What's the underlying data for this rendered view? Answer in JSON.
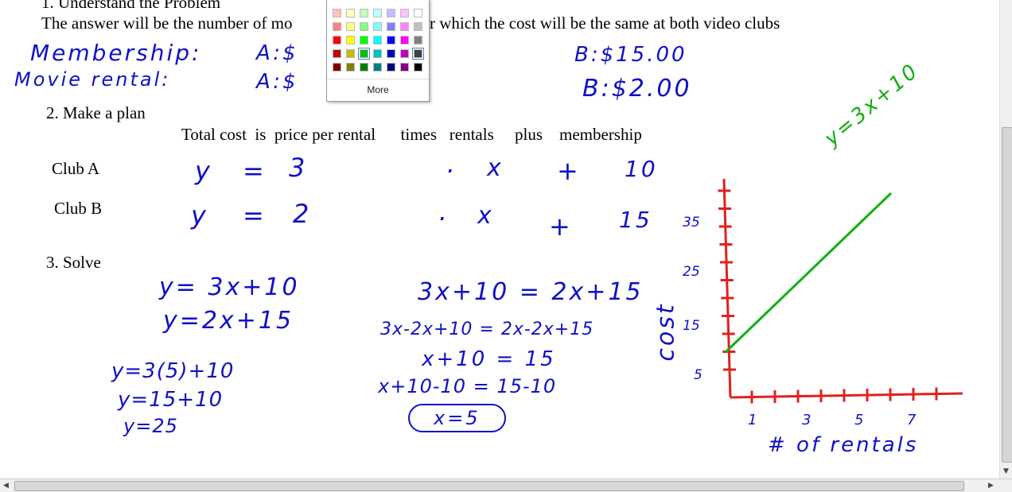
{
  "text": {
    "step1": "1. Understand the Problem",
    "answer": "The answer will be the number of mo",
    "answer_rest": "r which the cost will be the same at both video clubs",
    "step2": "2. Make a plan",
    "plan": "Total cost  is  price per rental      times   rentals     plus    membership",
    "clubA": "Club A",
    "clubB": "Club B",
    "step3": "3. Solve"
  },
  "handwriting": {
    "membership": "Membership:",
    "rental": "Movie rental:",
    "memA": "A:$",
    "rentA": "A:$",
    "memB": "B:$15.00",
    "rentB": "B:$2.00",
    "clubA_eq": [
      "y",
      "=",
      "3",
      "·",
      "x",
      "+",
      "10"
    ],
    "clubB_eq": [
      "y",
      "=",
      "2",
      "·",
      "x",
      "+",
      "15"
    ],
    "sys1": "y= 3x+10",
    "sys2": "y=2x+15",
    "s1": "3x+10 = 2x+15",
    "s2": "3x-2x+10 = 2x-2x+15",
    "s3": "x+10 = 15",
    "s4": "x+10-10 = 15-10",
    "s5": "x=5",
    "b1": "y=3(5)+10",
    "b2": "y=15+10",
    "b3": "y=25",
    "graph_label": "y=3x+10",
    "ylabel": "cost",
    "xlabel": "# of rentals",
    "yticks": [
      "35",
      "25",
      "15",
      "5"
    ],
    "xticks": [
      "1",
      "3",
      "5",
      "7"
    ]
  },
  "color_picker": {
    "more_label": "More",
    "colors": [
      [
        "#ffc0c0",
        "#ffffc0",
        "#c0ffc0",
        "#c0ffff",
        "#c0c0ff",
        "#ffc0ff",
        "#ffffff"
      ],
      [
        "#ff8080",
        "#ffff80",
        "#80ff80",
        "#80ffff",
        "#8080ff",
        "#ff80ff",
        "#c0c0c0"
      ],
      [
        "#ff0000",
        "#ffff00",
        "#00ff00",
        "#00ffff",
        "#0000ff",
        "#ff00ff",
        "#808080"
      ],
      [
        "#c00000",
        "#c0c000",
        "#00c000",
        "#00c0c0",
        "#0000c0",
        "#c000c0",
        "#404040"
      ],
      [
        "#800000",
        "#808000",
        "#008000",
        "#008080",
        "#000080",
        "#800080",
        "#000000"
      ]
    ]
  },
  "colors": {
    "ink": "#1010c8",
    "axes": "#e02020",
    "line": "#10b010"
  }
}
